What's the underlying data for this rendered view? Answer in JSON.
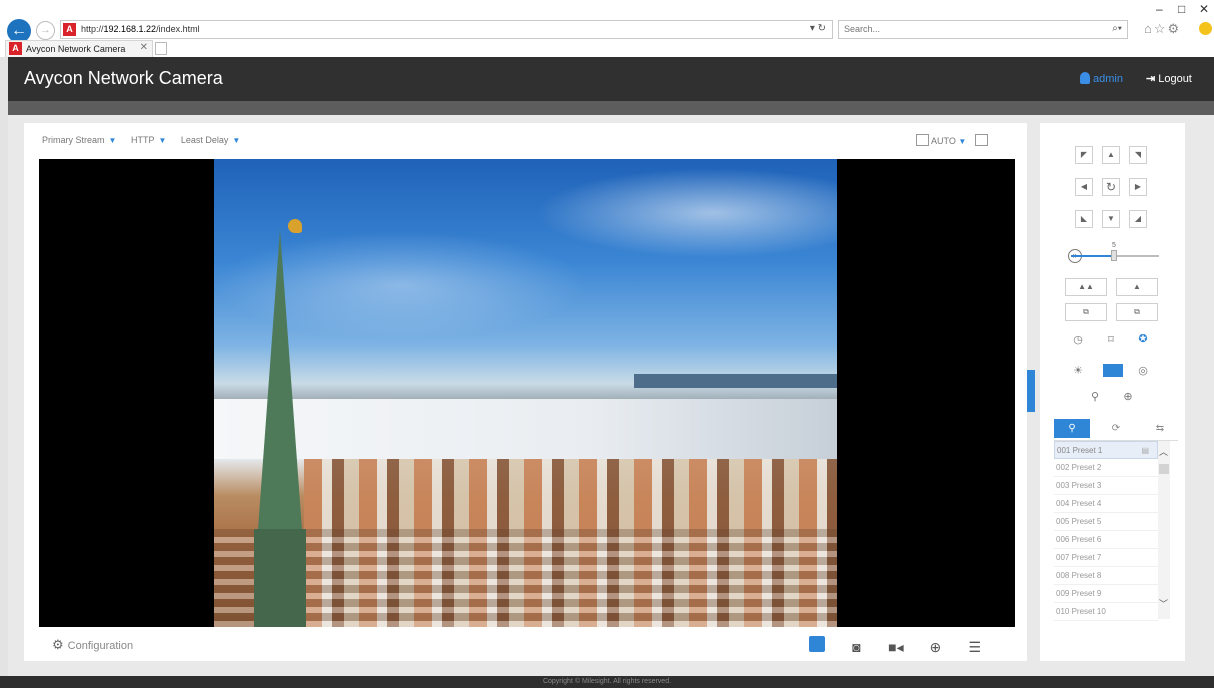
{
  "browser": {
    "url_prefix": "http://",
    "url_host": "192.168.1.22",
    "url_path": "/index.html",
    "search_placeholder": "Search...",
    "tab_title": "Avycon Network Camera",
    "favicon_letter": "A"
  },
  "app": {
    "title": "Avycon Network Camera",
    "username": "admin",
    "logout_label": "Logout",
    "footer": "Copyright © Milesight. All rights reserved."
  },
  "stream": {
    "stream_type": "Primary Stream",
    "protocol": "HTTP",
    "delay_mode": "Least Delay",
    "view_mode": "AUTO",
    "config_label": "Configuration"
  },
  "ptz": {
    "speed_value": "5",
    "presets": [
      "001 Preset 1",
      "002 Preset 2",
      "003 Preset 3",
      "004 Preset 4",
      "005 Preset 5",
      "006 Preset 6",
      "007 Preset 7",
      "008 Preset 8",
      "009 Preset 9",
      "010 Preset 10"
    ]
  },
  "colors": {
    "accent": "#2f86d6",
    "header_bg": "#303030",
    "footer_bg": "#2e2e2e"
  }
}
